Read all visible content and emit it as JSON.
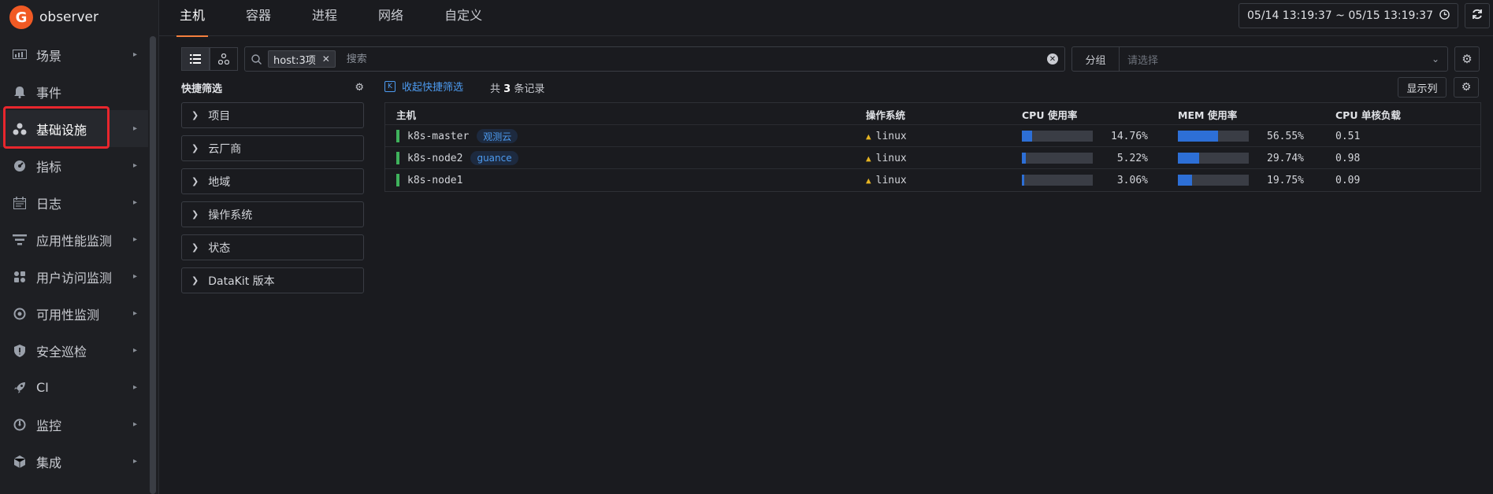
{
  "brand": {
    "name": "observer",
    "logo_letter": "G"
  },
  "sidebar": {
    "items": [
      {
        "label": "场景",
        "icon": "dashboard-icon"
      },
      {
        "label": "事件",
        "icon": "bell-icon"
      },
      {
        "label": "基础设施",
        "icon": "infrastructure-icon",
        "active": true
      },
      {
        "label": "指标",
        "icon": "metrics-icon"
      },
      {
        "label": "日志",
        "icon": "log-icon"
      },
      {
        "label": "应用性能监测",
        "icon": "apm-icon"
      },
      {
        "label": "用户访问监测",
        "icon": "rum-icon"
      },
      {
        "label": "可用性监测",
        "icon": "dial-icon"
      },
      {
        "label": "安全巡检",
        "icon": "shield-icon"
      },
      {
        "label": "CI",
        "icon": "rocket-icon"
      },
      {
        "label": "监控",
        "icon": "monitor-icon"
      },
      {
        "label": "集成",
        "icon": "cube-icon"
      }
    ]
  },
  "topbar": {
    "tabs": [
      "主机",
      "容器",
      "进程",
      "网络",
      "自定义"
    ],
    "active_tab": "主机",
    "time_range": "05/14 13:19:37 ~ 05/15 13:19:37"
  },
  "search": {
    "tag": "host:3项",
    "placeholder": "搜索"
  },
  "group": {
    "label": "分组",
    "placeholder": "请选择"
  },
  "quick_filter": {
    "title": "快捷筛选",
    "items": [
      "项目",
      "云厂商",
      "地域",
      "操作系统",
      "状态",
      "DataKit 版本"
    ]
  },
  "table_bar": {
    "collapse_label": "收起快捷筛选",
    "count_prefix": "共",
    "count": "3",
    "count_suffix": "条记录",
    "columns_button": "显示列"
  },
  "table": {
    "headers": {
      "host": "主机",
      "os": "操作系统",
      "cpu": "CPU 使用率",
      "mem": "MEM 使用率",
      "load": "CPU 单核负载"
    },
    "rows": [
      {
        "host": "k8s-master",
        "label": "观测云",
        "os": "linux",
        "cpu": "14.76%",
        "cpu_value": 14.76,
        "mem": "56.55%",
        "mem_value": 56.55,
        "load": "0.51"
      },
      {
        "host": "k8s-node2",
        "label": "guance",
        "os": "linux",
        "cpu": "5.22%",
        "cpu_value": 5.22,
        "mem": "29.74%",
        "mem_value": 29.74,
        "load": "0.98"
      },
      {
        "host": "k8s-node1",
        "label": "",
        "os": "linux",
        "cpu": "3.06%",
        "cpu_value": 3.06,
        "mem": "19.75%",
        "mem_value": 19.75,
        "load": "0.09"
      }
    ]
  },
  "colors": {
    "accent": "#f5803e",
    "link": "#4d9bf0",
    "bar_fill": "#2d6fd6",
    "status_ok": "#3fb25c",
    "highlight": "#e8262d"
  }
}
